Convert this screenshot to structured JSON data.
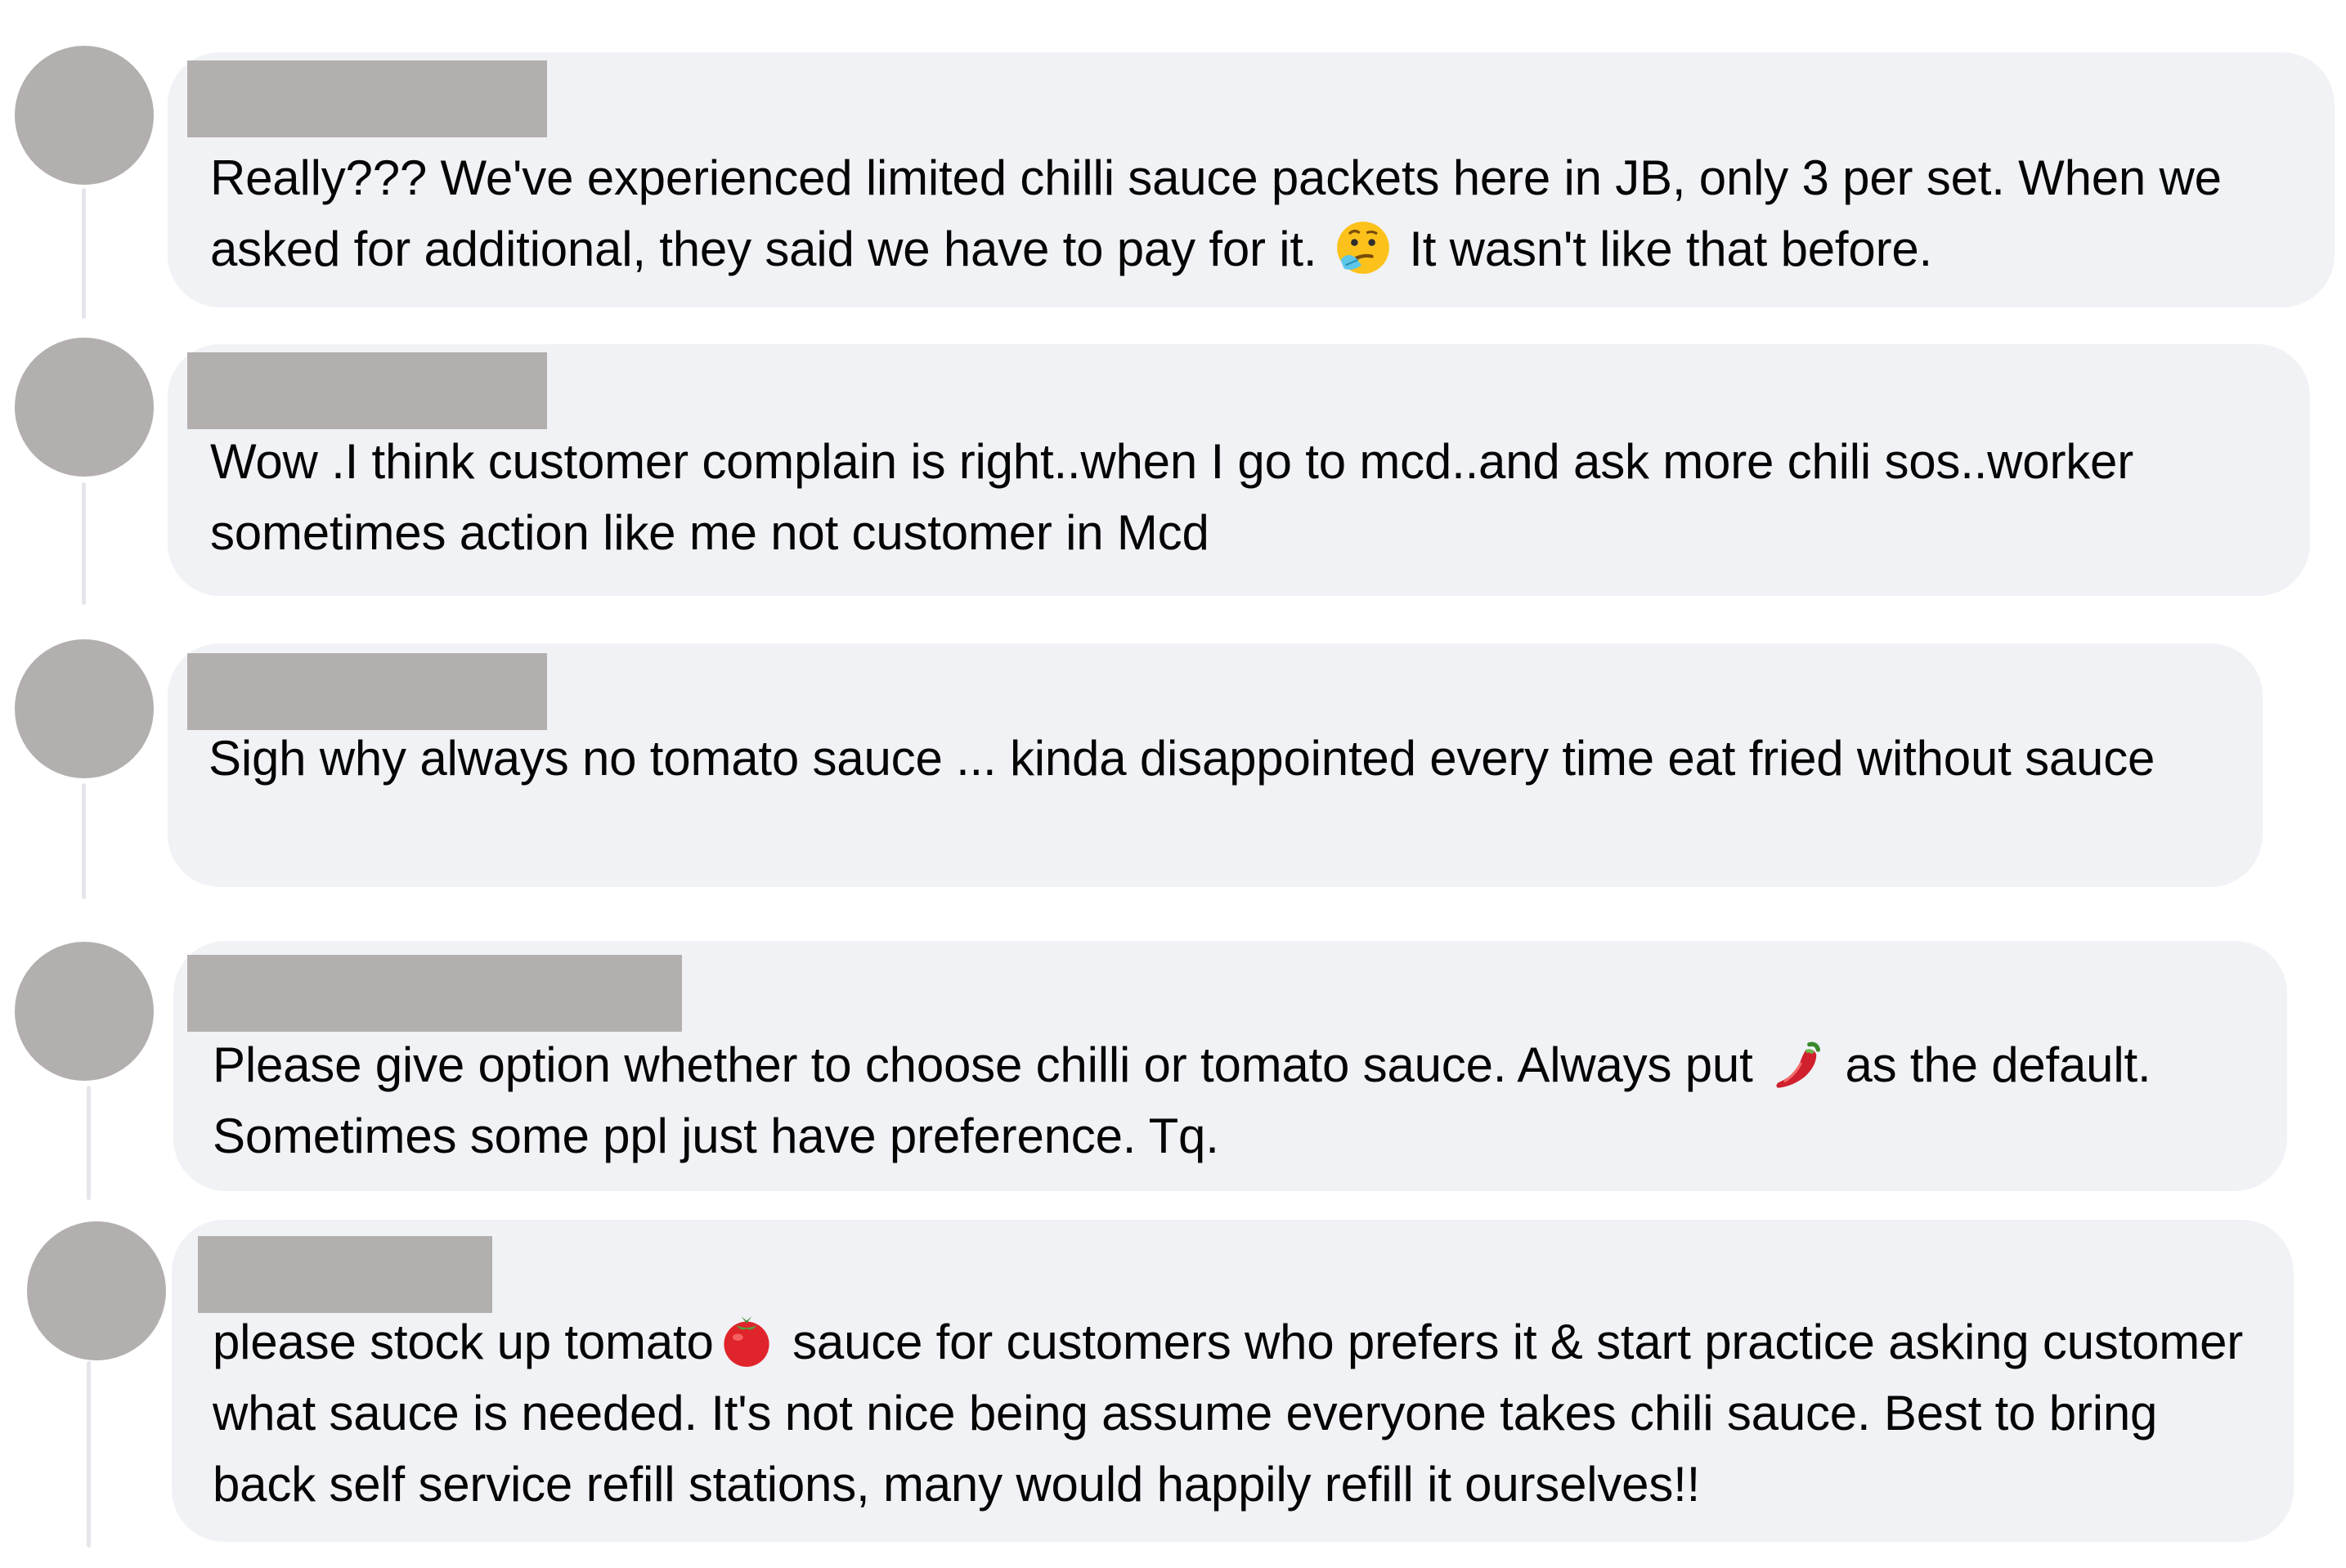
{
  "comments": [
    {
      "author_redacted": true,
      "text_before_emoji": "Really??? We've experienced limited chilli sauce packets here in JB, only 3 per set. When we asked for additional, they said we have to pay for it. ",
      "emoji": "thinking-face-icon",
      "text_after_emoji": " It wasn't like that before."
    },
    {
      "author_redacted": true,
      "text_before_emoji": "Wow .I think customer complain is right..when I go to mcd..and ask more chili sos..worker sometimes action like me not customer in Mcd",
      "emoji": "",
      "text_after_emoji": ""
    },
    {
      "author_redacted": true,
      "text_before_emoji": "Sigh why always no tomato sauce ... kinda disappointed every time eat fried without sauce",
      "emoji": "",
      "text_after_emoji": ""
    },
    {
      "author_redacted": true,
      "text_before_emoji": "Please give option whether to choose chilli or tomato sauce. Always put ",
      "emoji": "hot-pepper-icon",
      "text_after_emoji": " as the default. Sometimes some ppl just have preference. Tq."
    },
    {
      "author_redacted": true,
      "text_before_emoji": "please stock up tomato",
      "emoji": "tomato-icon",
      "text_after_emoji": " sauce for customers who prefers it & start practice asking customer what sauce is needed. It's not nice being assume everyone takes chili sauce. Best to bring back self service refill stations, many would happily refill it ourselves!!"
    }
  ],
  "colors": {
    "bubble": "#f0f2f5",
    "avatar_placeholder": "#b3afae",
    "thread_line": "#e4e6eb",
    "text": "#050505"
  }
}
